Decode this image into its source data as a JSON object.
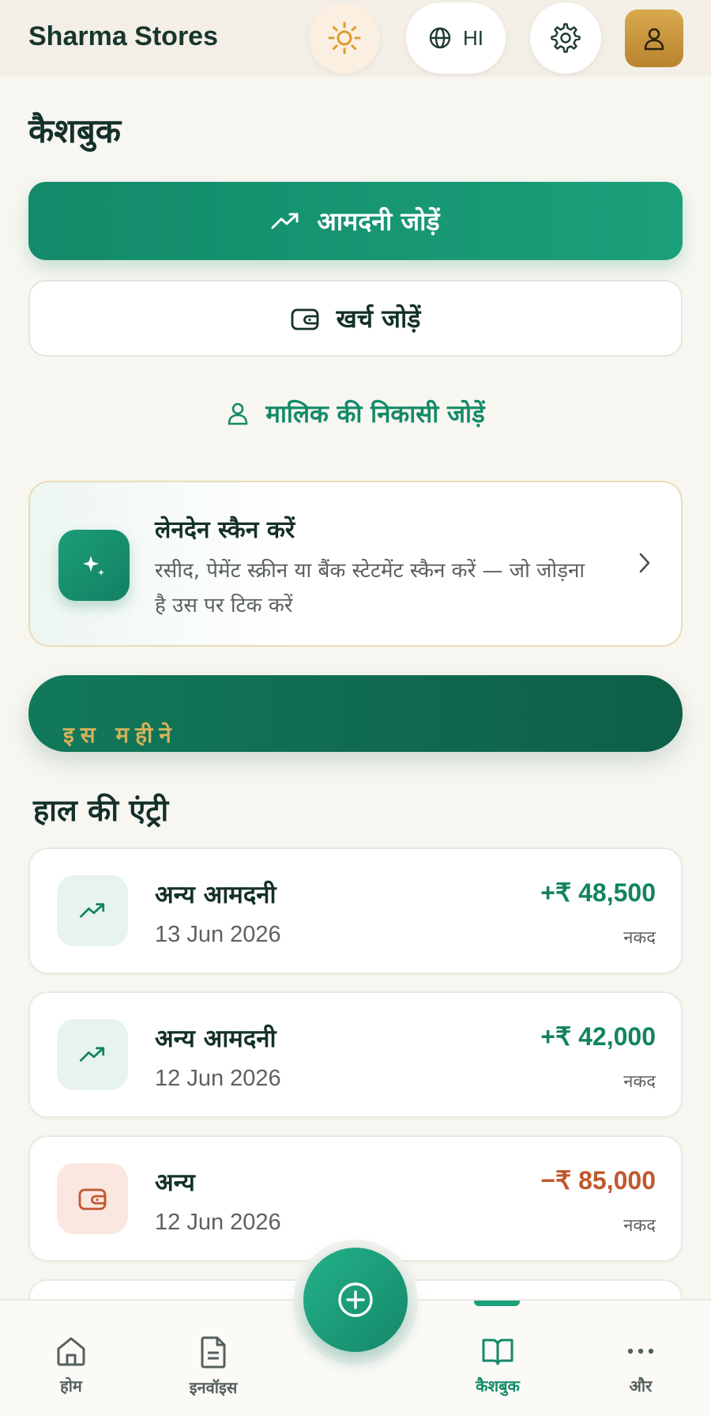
{
  "header": {
    "brand": "Sharma Stores",
    "theme_icon": "sun-icon",
    "language_label": "HI",
    "language_icon": "globe-icon",
    "settings_icon": "gear-icon",
    "profile_icon": "user-icon"
  },
  "page": {
    "title": "कैशबुक"
  },
  "actions": {
    "add_income": "आमदनी जोड़ें",
    "add_expense": "खर्च जोड़ें",
    "add_owner_withdrawal": "मालिक की निकासी जोड़ें"
  },
  "scan_card": {
    "title": "लेनदेन स्कैन करें",
    "description": "रसीद, पेमेंट स्क्रीन या बैंक स्टेटमेंट स्कैन करें — जो जोड़ना है उस पर टिक करें"
  },
  "month_card": {
    "label": "इस महीने"
  },
  "recent": {
    "title": "हाल की एंट्री",
    "entries": [
      {
        "name": "अन्य आमदनी",
        "date": "13 Jun 2026",
        "amount": "+₹ 48,500",
        "mode": "नकद",
        "type": "income"
      },
      {
        "name": "अन्य आमदनी",
        "date": "12 Jun 2026",
        "amount": "+₹ 42,000",
        "mode": "नकद",
        "type": "income"
      },
      {
        "name": "अन्य",
        "date": "12 Jun 2026",
        "amount": "−₹ 85,000",
        "mode": "नकद",
        "type": "expense"
      }
    ]
  },
  "nav": {
    "home": "होम",
    "invoice": "इनवॉइस",
    "cashbook": "कैशबुक",
    "more": "और",
    "active": "cashbook"
  },
  "colors": {
    "primary": "#1ba07a",
    "primary_dark": "#0e5f47",
    "gold": "#d3b25b",
    "income": "#12835f",
    "expense": "#c0582e",
    "background": "#f8f6f1"
  }
}
